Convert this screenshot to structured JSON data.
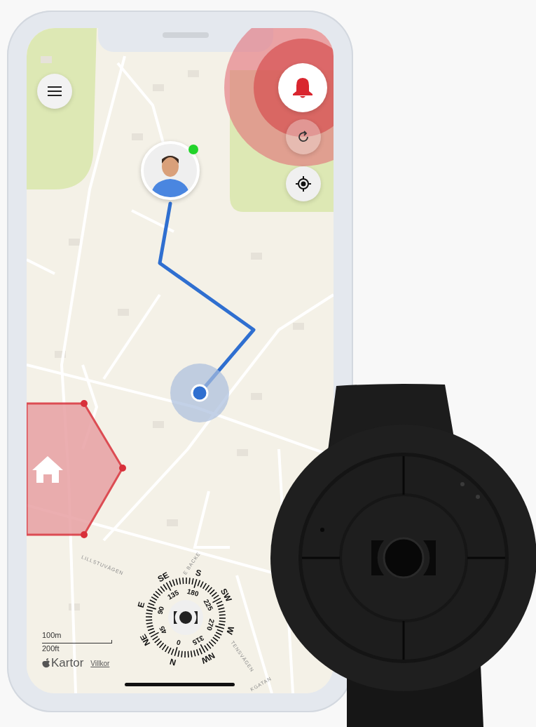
{
  "map": {
    "streets": [
      {
        "name": "LILLSTUVÄGEN"
      },
      {
        "name": "E BACKE"
      },
      {
        "name": "TENSVÄGEN"
      },
      {
        "name": "KGATAN"
      }
    ],
    "scale": {
      "metric": "100m",
      "imperial": "200ft"
    },
    "attribution": {
      "brand": "Kartor",
      "terms_link": "Villkor"
    }
  },
  "person": {
    "online": true
  },
  "alarm": {
    "active": true
  },
  "compass": {
    "headings": [
      "N",
      "NE",
      "E",
      "SE",
      "S",
      "SW",
      "W",
      "NW"
    ],
    "degrees": [
      "0",
      "45",
      "90",
      "135",
      "180",
      "225",
      "270",
      "315"
    ]
  }
}
